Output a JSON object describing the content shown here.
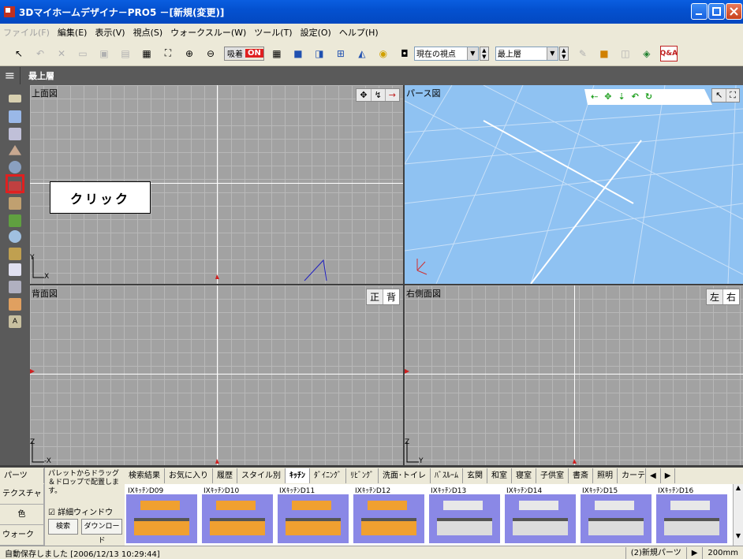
{
  "window": {
    "title": "3Dマイホームデザイナ－PRO5 －[新規(変更)]"
  },
  "menu": [
    "ファイル(F)",
    "編集(E)",
    "表示(V)",
    "視点(S)",
    "ウォークスルー(W)",
    "ツール(T)",
    "設定(O)",
    "ヘルプ(H)"
  ],
  "toolbar": {
    "snap_label": "吸着",
    "snap_state": "ON",
    "viewpoint": "現在の視点",
    "floor": "最上層",
    "qa": "Q&A"
  },
  "floorbar": {
    "current": "最上層"
  },
  "views": {
    "top": {
      "label": "上面図",
      "axis_y": "Y",
      "axis_x": "X"
    },
    "persp": {
      "label": "パース図"
    },
    "back": {
      "label": "背面図",
      "btn_front": "正",
      "btn_back": "背",
      "axis_z": "Z",
      "axis_x": "-X"
    },
    "right": {
      "label": "右側面図",
      "btn_left": "左",
      "btn_right": "右",
      "axis_z": "Z",
      "axis_y": "Y"
    }
  },
  "callout": "クリック",
  "palette": {
    "side_tabs": [
      "パーツ",
      "テクスチャ",
      "色",
      "ウォーク"
    ],
    "hint": "パレットからドラッグ＆ドロップで配置します。",
    "detail_window": "詳細ウィンドウ",
    "search_btn": "検索",
    "download_btn": "ダウンロード",
    "tabs": [
      "検索結果",
      "お気に入り",
      "履歴",
      "スタイル別",
      "ｷｯﾁﾝ",
      "ﾀﾞｲﾆﾝｸﾞ",
      "ﾘﾋﾞﾝｸﾞ",
      "洗面･トイレ",
      "ﾊﾞｽﾙｰﾑ",
      "玄関",
      "和室",
      "寝室",
      "子供室",
      "書斎",
      "照明",
      "カーテン･ラ"
    ],
    "active_tab": "ｷｯﾁﾝ",
    "items": [
      "IXｷｯﾁﾝD09",
      "IXｷｯﾁﾝD10",
      "IXｷｯﾁﾝD11",
      "IXｷｯﾁﾝD12",
      "IXｷｯﾁﾝD13",
      "IXｷｯﾁﾝD14",
      "IXｷｯﾁﾝD15",
      "IXｷｯﾁﾝD16"
    ]
  },
  "status": {
    "message": "自動保存しました [2006/12/13 10:29:44]",
    "parts": "(2)新規パーツ",
    "grid": "200mm"
  }
}
